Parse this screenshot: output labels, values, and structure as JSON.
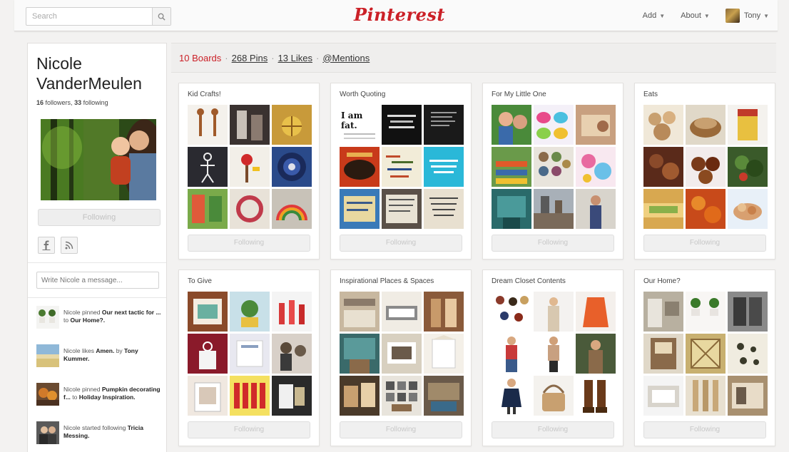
{
  "header": {
    "search_placeholder": "Search",
    "logo": "Pinterest",
    "nav": {
      "add": "Add",
      "about": "About",
      "user": "Tony"
    }
  },
  "profile": {
    "name": "Nicole VanderMeulen",
    "followers": "16",
    "followers_label": "followers,",
    "following": "33",
    "following_label": "following",
    "follow_button": "Following",
    "message_placeholder": "Write Nicole a message..."
  },
  "activity": [
    {
      "actor": "Nicole pinned ",
      "object": "Our next tactic for ...",
      "middle": " to ",
      "target": "Our Home?."
    },
    {
      "actor": "Nicole likes ",
      "object": "Amen.",
      "middle": " by ",
      "target": "Tony Kummer."
    },
    {
      "actor": "Nicole pinned ",
      "object": "Pumpkin decorating f...",
      "middle": " to ",
      "target": "Holiday Inspiration."
    },
    {
      "actor": "Nicole started following ",
      "object": "Tricia Messing.",
      "middle": "",
      "target": ""
    }
  ],
  "stats": {
    "boards": "10 Boards",
    "pins": "268 Pins",
    "likes": "13 Likes",
    "mentions": "@Mentions",
    "separator": "·"
  },
  "boards": [
    {
      "title": "Kid Crafts!",
      "follow": "Following"
    },
    {
      "title": "Worth Quoting",
      "follow": "Following"
    },
    {
      "title": "For My Little One",
      "follow": "Following"
    },
    {
      "title": "Eats",
      "follow": "Following"
    },
    {
      "title": "To Give",
      "follow": "Following"
    },
    {
      "title": "Inspirational Places & Spaces",
      "follow": "Following"
    },
    {
      "title": "Dream Closet Contents",
      "follow": "Following"
    },
    {
      "title": "Our Home?",
      "follow": "Following"
    }
  ],
  "quote_pins": {
    "i_am_fat": "I am fat."
  },
  "colors": {
    "brand_red": "#cb2027",
    "page_bg": "#f3f2f1",
    "card_bg": "#ffffff"
  }
}
